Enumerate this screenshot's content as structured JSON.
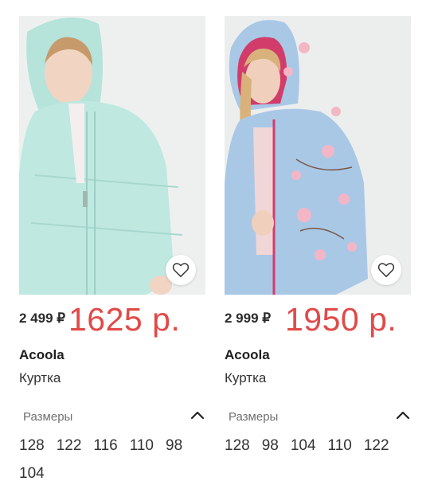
{
  "products": [
    {
      "old_price": "2 499 ₽",
      "new_price": "1625 р.",
      "brand": "Acoola",
      "type": "Куртка",
      "sizes_label": "Размеры",
      "sizes": [
        "128",
        "122",
        "116",
        "110",
        "98",
        "104"
      ],
      "jacket_color": "#bfe8e0",
      "favorite_icon": "heart-icon",
      "toggle_icon": "chevron-up-icon"
    },
    {
      "old_price": "2 999 ₽",
      "new_price": "1950 р.",
      "brand": "Acoola",
      "type": "Куртка",
      "sizes_label": "Размеры",
      "sizes": [
        "128",
        "98",
        "104",
        "110",
        "122"
      ],
      "jacket_color": "#a9c8e6",
      "favorite_icon": "heart-icon",
      "toggle_icon": "chevron-up-icon"
    }
  ],
  "colors": {
    "sale_price": "#e04a48",
    "background": "#ffffff"
  }
}
